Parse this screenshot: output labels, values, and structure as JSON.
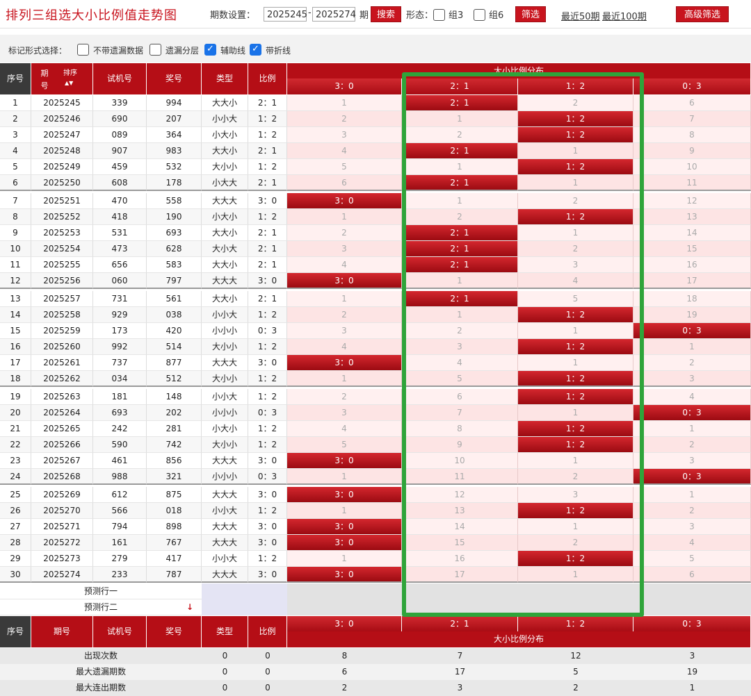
{
  "title": "排列三组选大小比例值走势图",
  "toolbar": {
    "period_label": "期数设置：",
    "start": "2025245",
    "dash": "-",
    "end": "2025274",
    "period_unit": "期",
    "search": "搜索",
    "form_label": "形态：",
    "group3": "组3",
    "group6": "组6",
    "filter": "筛选",
    "recent50": "最近50期",
    "recent100": "最近100期",
    "advanced": "高级筛选"
  },
  "options": {
    "label": "标记形式选择：",
    "items": [
      {
        "label": "不带遗漏数据",
        "checked": false
      },
      {
        "label": "遗漏分层",
        "checked": false
      },
      {
        "label": "辅助线",
        "checked": true
      },
      {
        "label": "带折线",
        "checked": true
      }
    ]
  },
  "headers": {
    "seq": "序号",
    "period": "期号",
    "sort": "排序",
    "trial": "试机号",
    "prize": "奖号",
    "type": "类型",
    "ratio": "比例",
    "dist": "大小比例分布",
    "dist_cols": [
      "3：0",
      "2：1",
      "1：2",
      "0：3"
    ]
  },
  "rows": [
    {
      "seq": "1",
      "period": "2025245",
      "trial": "339",
      "prize": "994",
      "type": "大大小",
      "ratio": "2：1",
      "cells": [
        "1",
        "2：1",
        "2",
        "6"
      ],
      "hit": 1
    },
    {
      "seq": "2",
      "period": "2025246",
      "trial": "690",
      "prize": "207",
      "type": "小小大",
      "ratio": "1：2",
      "cells": [
        "2",
        "1",
        "1：2",
        "7"
      ],
      "hit": 2
    },
    {
      "seq": "3",
      "period": "2025247",
      "trial": "089",
      "prize": "364",
      "type": "小大小",
      "ratio": "1：2",
      "cells": [
        "3",
        "2",
        "1：2",
        "8"
      ],
      "hit": 2
    },
    {
      "seq": "4",
      "period": "2025248",
      "trial": "907",
      "prize": "983",
      "type": "大大小",
      "ratio": "2：1",
      "cells": [
        "4",
        "2：1",
        "1",
        "9"
      ],
      "hit": 1
    },
    {
      "seq": "5",
      "period": "2025249",
      "trial": "459",
      "prize": "532",
      "type": "大小小",
      "ratio": "1：2",
      "cells": [
        "5",
        "1",
        "1：2",
        "10"
      ],
      "hit": 2
    },
    {
      "seq": "6",
      "period": "2025250",
      "trial": "608",
      "prize": "178",
      "type": "小大大",
      "ratio": "2：1",
      "cells": [
        "6",
        "2：1",
        "1",
        "11"
      ],
      "hit": 1
    },
    {
      "seq": "7",
      "period": "2025251",
      "trial": "470",
      "prize": "558",
      "type": "大大大",
      "ratio": "3：0",
      "cells": [
        "3：0",
        "1",
        "2",
        "12"
      ],
      "hit": 0
    },
    {
      "seq": "8",
      "period": "2025252",
      "trial": "418",
      "prize": "190",
      "type": "小大小",
      "ratio": "1：2",
      "cells": [
        "1",
        "2",
        "1：2",
        "13"
      ],
      "hit": 2
    },
    {
      "seq": "9",
      "period": "2025253",
      "trial": "531",
      "prize": "693",
      "type": "大大小",
      "ratio": "2：1",
      "cells": [
        "2",
        "2：1",
        "1",
        "14"
      ],
      "hit": 1
    },
    {
      "seq": "10",
      "period": "2025254",
      "trial": "473",
      "prize": "628",
      "type": "大小大",
      "ratio": "2：1",
      "cells": [
        "3",
        "2：1",
        "2",
        "15"
      ],
      "hit": 1
    },
    {
      "seq": "11",
      "period": "2025255",
      "trial": "656",
      "prize": "583",
      "type": "大大小",
      "ratio": "2：1",
      "cells": [
        "4",
        "2：1",
        "3",
        "16"
      ],
      "hit": 1
    },
    {
      "seq": "12",
      "period": "2025256",
      "trial": "060",
      "prize": "797",
      "type": "大大大",
      "ratio": "3：0",
      "cells": [
        "3：0",
        "1",
        "4",
        "17"
      ],
      "hit": 0
    },
    {
      "seq": "13",
      "period": "2025257",
      "trial": "731",
      "prize": "561",
      "type": "大大小",
      "ratio": "2：1",
      "cells": [
        "1",
        "2：1",
        "5",
        "18"
      ],
      "hit": 1
    },
    {
      "seq": "14",
      "period": "2025258",
      "trial": "929",
      "prize": "038",
      "type": "小小大",
      "ratio": "1：2",
      "cells": [
        "2",
        "1",
        "1：2",
        "19"
      ],
      "hit": 2
    },
    {
      "seq": "15",
      "period": "2025259",
      "trial": "173",
      "prize": "420",
      "type": "小小小",
      "ratio": "0：3",
      "cells": [
        "3",
        "2",
        "1",
        "0：3"
      ],
      "hit": 3
    },
    {
      "seq": "16",
      "period": "2025260",
      "trial": "992",
      "prize": "514",
      "type": "大小小",
      "ratio": "1：2",
      "cells": [
        "4",
        "3",
        "1：2",
        "1"
      ],
      "hit": 2
    },
    {
      "seq": "17",
      "period": "2025261",
      "trial": "737",
      "prize": "877",
      "type": "大大大",
      "ratio": "3：0",
      "cells": [
        "3：0",
        "4",
        "1",
        "2"
      ],
      "hit": 0
    },
    {
      "seq": "18",
      "period": "2025262",
      "trial": "034",
      "prize": "512",
      "type": "大小小",
      "ratio": "1：2",
      "cells": [
        "1",
        "5",
        "1：2",
        "3"
      ],
      "hit": 2
    },
    {
      "seq": "19",
      "period": "2025263",
      "trial": "181",
      "prize": "148",
      "type": "小小大",
      "ratio": "1：2",
      "cells": [
        "2",
        "6",
        "1：2",
        "4"
      ],
      "hit": 2
    },
    {
      "seq": "20",
      "period": "2025264",
      "trial": "693",
      "prize": "202",
      "type": "小小小",
      "ratio": "0：3",
      "cells": [
        "3",
        "7",
        "1",
        "0：3"
      ],
      "hit": 3
    },
    {
      "seq": "21",
      "period": "2025265",
      "trial": "242",
      "prize": "281",
      "type": "小大小",
      "ratio": "1：2",
      "cells": [
        "4",
        "8",
        "1：2",
        "1"
      ],
      "hit": 2
    },
    {
      "seq": "22",
      "period": "2025266",
      "trial": "590",
      "prize": "742",
      "type": "大小小",
      "ratio": "1：2",
      "cells": [
        "5",
        "9",
        "1：2",
        "2"
      ],
      "hit": 2
    },
    {
      "seq": "23",
      "period": "2025267",
      "trial": "461",
      "prize": "856",
      "type": "大大大",
      "ratio": "3：0",
      "cells": [
        "3：0",
        "10",
        "1",
        "3"
      ],
      "hit": 0
    },
    {
      "seq": "24",
      "period": "2025268",
      "trial": "988",
      "prize": "321",
      "type": "小小小",
      "ratio": "0：3",
      "cells": [
        "1",
        "11",
        "2",
        "0：3"
      ],
      "hit": 3
    },
    {
      "seq": "25",
      "period": "2025269",
      "trial": "612",
      "prize": "875",
      "type": "大大大",
      "ratio": "3：0",
      "cells": [
        "3：0",
        "12",
        "3",
        "1"
      ],
      "hit": 0
    },
    {
      "seq": "26",
      "period": "2025270",
      "trial": "566",
      "prize": "018",
      "type": "小小大",
      "ratio": "1：2",
      "cells": [
        "1",
        "13",
        "1：2",
        "2"
      ],
      "hit": 2
    },
    {
      "seq": "27",
      "period": "2025271",
      "trial": "794",
      "prize": "898",
      "type": "大大大",
      "ratio": "3：0",
      "cells": [
        "3：0",
        "14",
        "1",
        "3"
      ],
      "hit": 0
    },
    {
      "seq": "28",
      "period": "2025272",
      "trial": "161",
      "prize": "767",
      "type": "大大大",
      "ratio": "3：0",
      "cells": [
        "3：0",
        "15",
        "2",
        "4"
      ],
      "hit": 0
    },
    {
      "seq": "29",
      "period": "2025273",
      "trial": "279",
      "prize": "417",
      "type": "小小大",
      "ratio": "1：2",
      "cells": [
        "1",
        "16",
        "1：2",
        "5"
      ],
      "hit": 2
    },
    {
      "seq": "30",
      "period": "2025274",
      "trial": "233",
      "prize": "787",
      "type": "大大大",
      "ratio": "3：0",
      "cells": [
        "3：0",
        "17",
        "1",
        "6"
      ],
      "hit": 0
    }
  ],
  "predict": [
    "预测行一",
    "预测行二"
  ],
  "stats": [
    {
      "label": "出现次数",
      "type": "0",
      "ratio": "0",
      "cells": [
        "8",
        "7",
        "12",
        "3"
      ]
    },
    {
      "label": "最大遗漏期数",
      "type": "0",
      "ratio": "0",
      "cells": [
        "6",
        "17",
        "5",
        "19"
      ]
    },
    {
      "label": "最大连出期数",
      "type": "0",
      "ratio": "0",
      "cells": [
        "2",
        "3",
        "2",
        "1"
      ]
    }
  ],
  "colors": {
    "accent": "#c8141e",
    "highlight": "#2fa43a"
  }
}
